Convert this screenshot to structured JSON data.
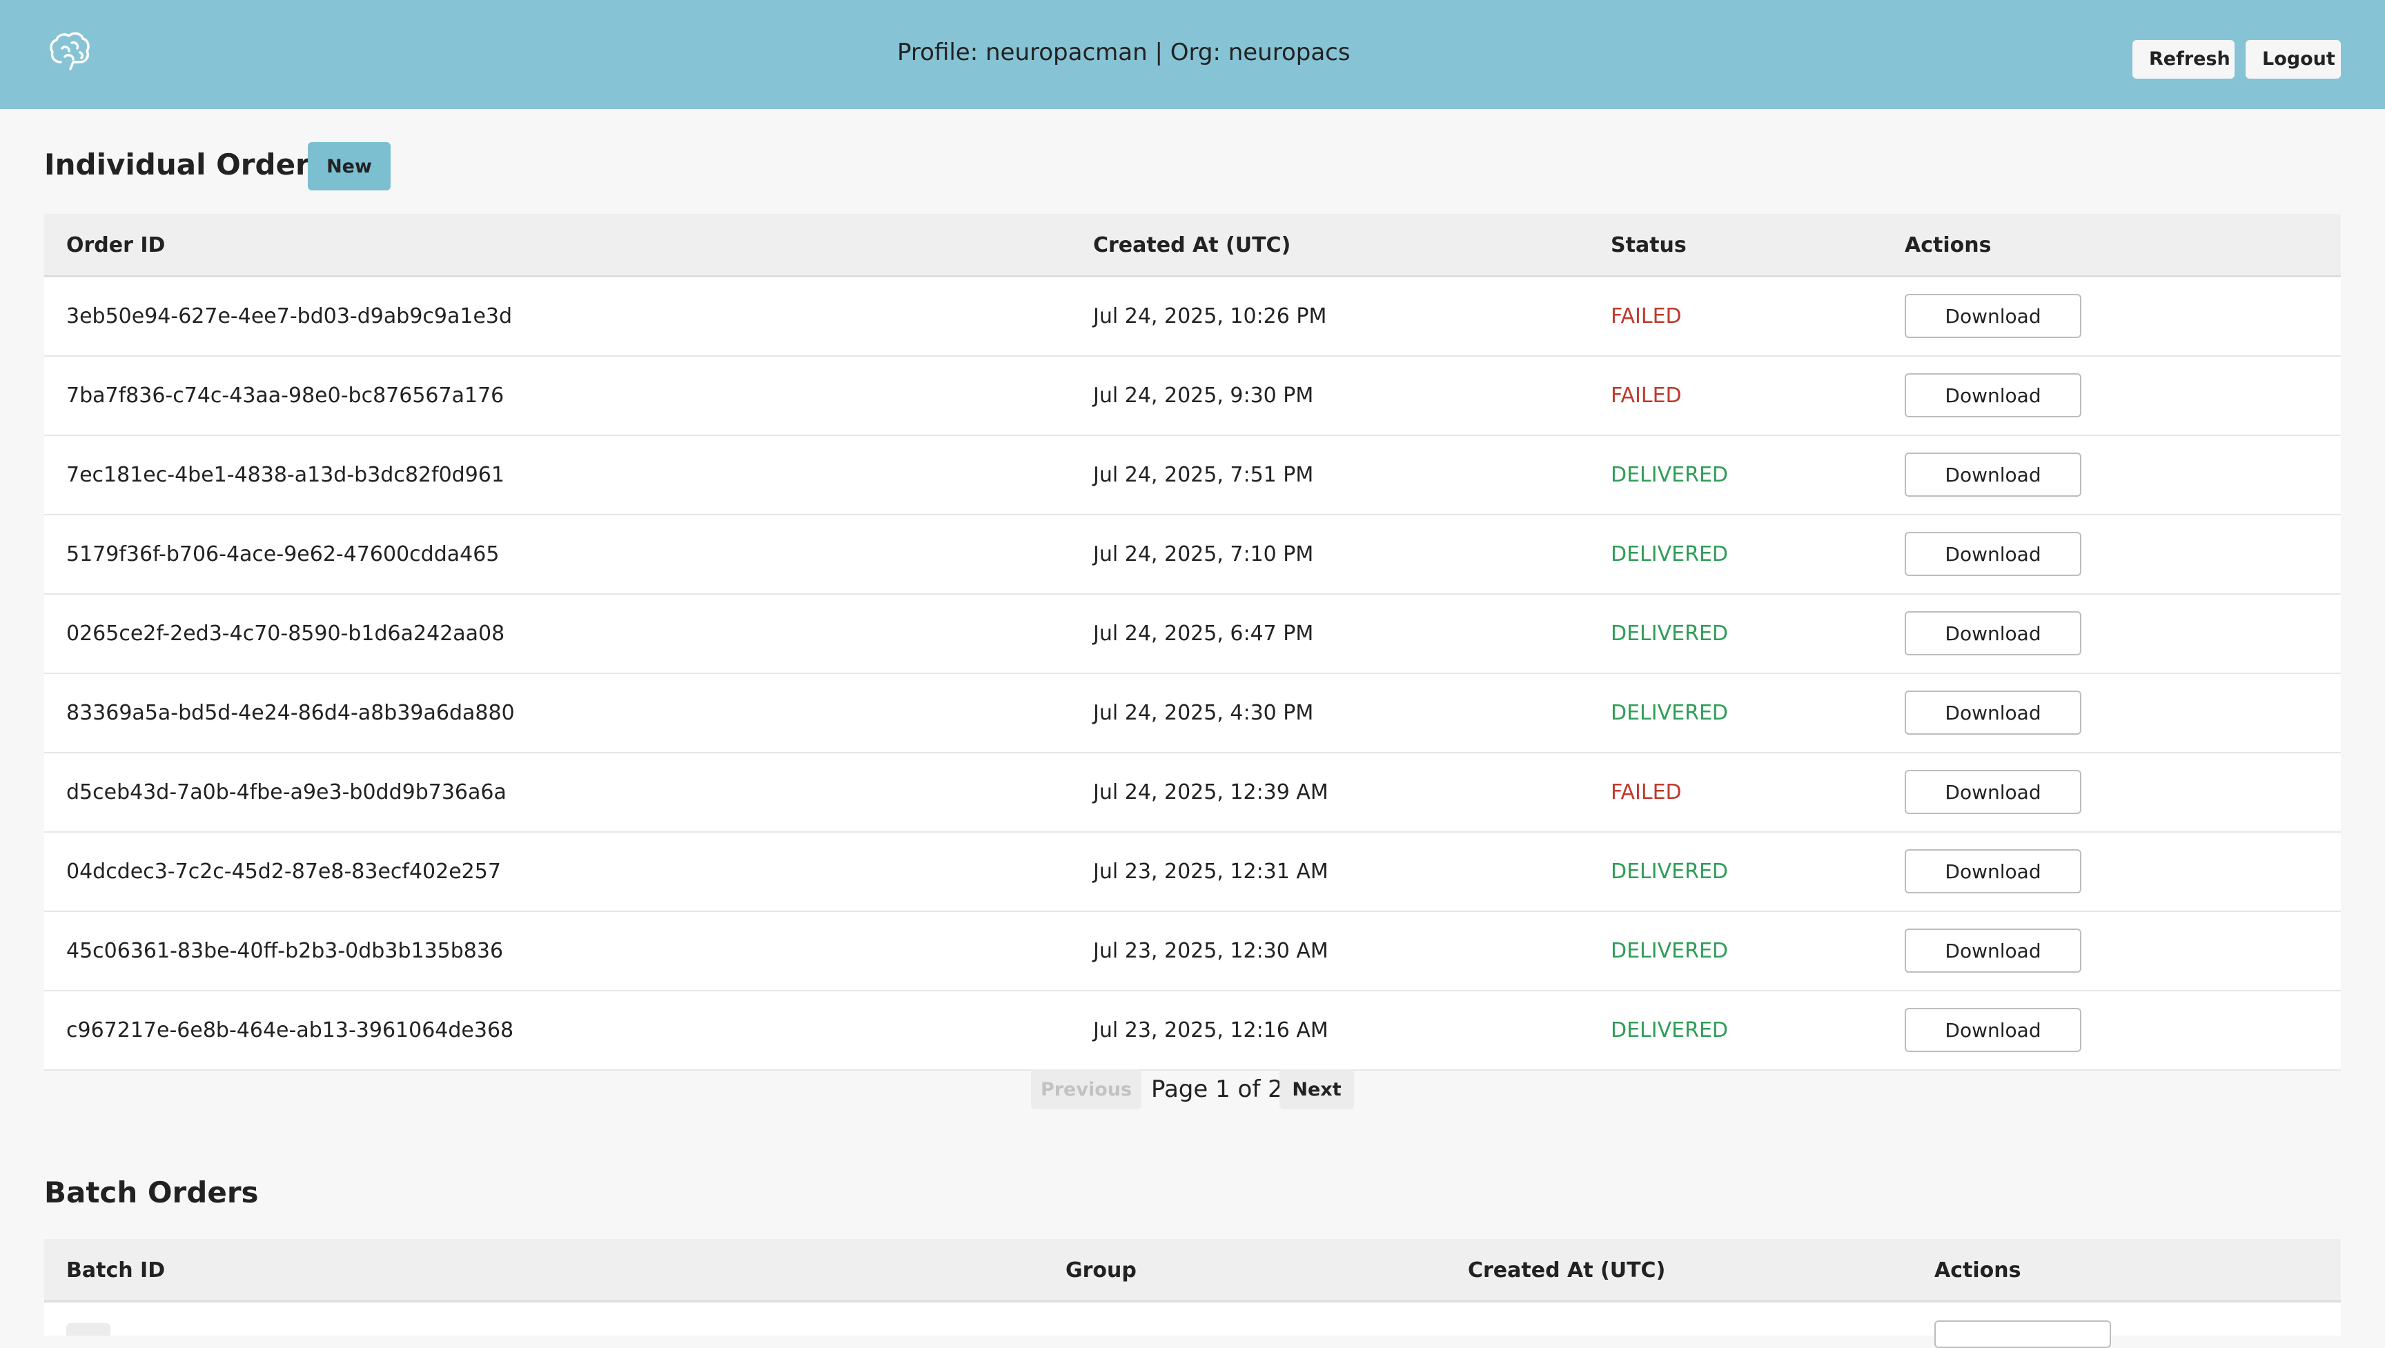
{
  "header": {
    "logo_icon": "brain-icon",
    "profile_text": "Profile: neuropacman | Org: neuropacs",
    "refresh_label": "Refresh",
    "logout_label": "Logout",
    "background_color": "#86c3d4"
  },
  "individual_orders": {
    "title": "Individual Orders",
    "new_label": "New",
    "columns": [
      "Order ID",
      "Created At (UTC)",
      "Status",
      "Actions"
    ],
    "rows": [
      {
        "id": "3eb50e94-627e-4ee7-bd03-d9ab9c9a1e3d",
        "created": "Jul 24, 2025, 10:26 PM",
        "status": "FAILED",
        "action": "Download"
      },
      {
        "id": "7ba7f836-c74c-43aa-98e0-bc876567a176",
        "created": "Jul 24, 2025, 9:30 PM",
        "status": "FAILED",
        "action": "Download"
      },
      {
        "id": "7ec181ec-4be1-4838-a13d-b3dc82f0d961",
        "created": "Jul 24, 2025, 7:51 PM",
        "status": "DELIVERED",
        "action": "Download"
      },
      {
        "id": "5179f36f-b706-4ace-9e62-47600cdda465",
        "created": "Jul 24, 2025, 7:10 PM",
        "status": "DELIVERED",
        "action": "Download"
      },
      {
        "id": "0265ce2f-2ed3-4c70-8590-b1d6a242aa08",
        "created": "Jul 24, 2025, 6:47 PM",
        "status": "DELIVERED",
        "action": "Download"
      },
      {
        "id": "83369a5a-bd5d-4e24-86d4-a8b39a6da880",
        "created": "Jul 24, 2025, 4:30 PM",
        "status": "DELIVERED",
        "action": "Download"
      },
      {
        "id": "d5ceb43d-7a0b-4fbe-a9e3-b0dd9b736a6a",
        "created": "Jul 24, 2025, 12:39 AM",
        "status": "FAILED",
        "action": "Download"
      },
      {
        "id": "04dcdec3-7c2c-45d2-87e8-83ecf402e257",
        "created": "Jul 23, 2025, 12:31 AM",
        "status": "DELIVERED",
        "action": "Download"
      },
      {
        "id": "45c06361-83be-40ff-b2b3-0db3b135b836",
        "created": "Jul 23, 2025, 12:30 AM",
        "status": "DELIVERED",
        "action": "Download"
      },
      {
        "id": "c967217e-6e8b-464e-ab13-3961064de368",
        "created": "Jul 23, 2025, 12:16 AM",
        "status": "DELIVERED",
        "action": "Download"
      }
    ],
    "status_colors": {
      "FAILED": "#c0392b",
      "DELIVERED": "#2e9e56"
    }
  },
  "pagination": {
    "previous_label": "Previous",
    "page_text": "Page 1 of 2",
    "next_label": "Next"
  },
  "batch_orders": {
    "title": "Batch Orders",
    "columns": [
      "Batch ID",
      "Group",
      "Created At (UTC)",
      "Actions"
    ]
  }
}
